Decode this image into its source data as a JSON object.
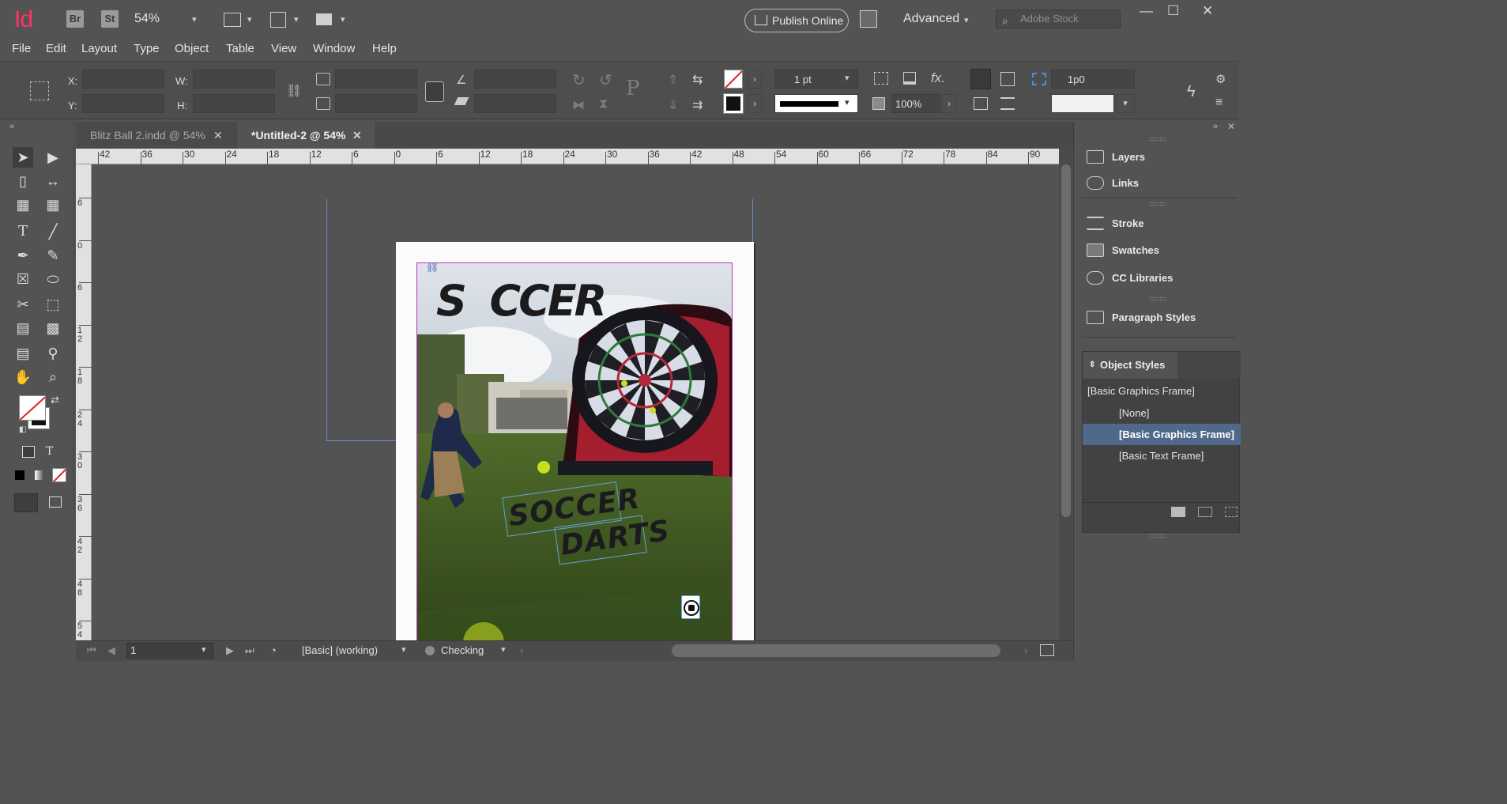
{
  "app": {
    "logo": "Id",
    "bridge": "Br",
    "stock_btn": "St",
    "zoom": "54%",
    "publish": "Publish Online",
    "workspace": "Advanced",
    "search_placeholder": "Adobe Stock"
  },
  "menu": [
    "File",
    "Edit",
    "Layout",
    "Type",
    "Object",
    "Table",
    "View",
    "Window",
    "Help"
  ],
  "control": {
    "x_label": "X:",
    "y_label": "Y:",
    "w_label": "W:",
    "h_label": "H:",
    "stroke_weight": "1 pt",
    "opacity": "100%",
    "gap": "1p0"
  },
  "tabs": [
    {
      "label": "Blitz Ball 2.indd @ 54%",
      "active": false
    },
    {
      "label": "*Untitled-2 @ 54%",
      "active": true
    }
  ],
  "ruler_h": [
    "42",
    "36",
    "30",
    "24",
    "18",
    "12",
    "6",
    "0",
    "6",
    "12",
    "18",
    "24",
    "30",
    "36",
    "42",
    "48",
    "54",
    "60",
    "66",
    "72",
    "78",
    "84",
    "90"
  ],
  "ruler_v": [
    "6",
    "0",
    "6",
    "1 2",
    "1 8",
    "2 4",
    "3 0",
    "3 6",
    "4 2",
    "4 8",
    "5 4"
  ],
  "document": {
    "headline": "S  CCER",
    "graphic_text_1": "SOCCER",
    "graphic_text_2": "DARTS"
  },
  "status": {
    "page": "1",
    "style": "[Basic] (working)",
    "preflight": "Checking"
  },
  "panels": {
    "items": [
      "Layers",
      "Links",
      "Stroke",
      "Swatches",
      "CC Libraries",
      "Paragraph Styles"
    ],
    "object_styles": {
      "title": "Object Styles",
      "current": "[Basic Graphics Frame]",
      "rows": [
        "[None]",
        "[Basic Graphics Frame]",
        "[Basic Text Frame]"
      ]
    }
  },
  "colors": {
    "accent": "#ff3366",
    "selection": "#50688a",
    "frame": "#c030c0",
    "guide": "#6a8fd0"
  }
}
